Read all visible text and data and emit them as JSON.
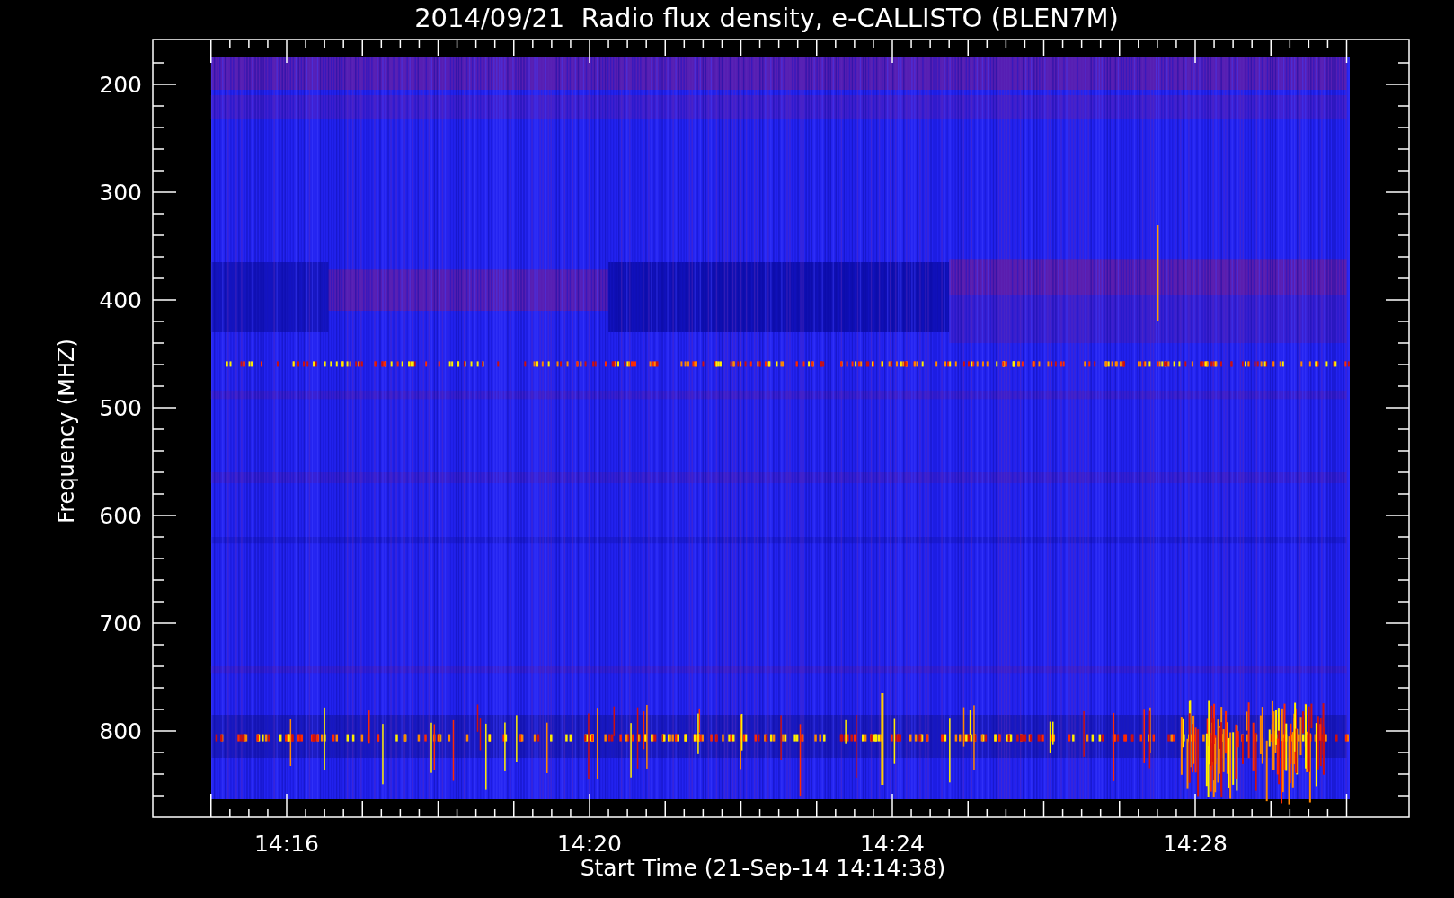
{
  "title": "2014/09/21  Radio flux density, e-CALLISTO (BLEN7M)",
  "plot": {
    "ylabel": "Frequency (MHZ)",
    "xlabel": "Start Time (21-Sep-14 14:14:38)",
    "yticks": [
      "200",
      "300",
      "400",
      "500",
      "600",
      "700",
      "800"
    ],
    "xticks": [
      "14:16",
      "14:20",
      "14:24",
      "14:28"
    ]
  }
}
